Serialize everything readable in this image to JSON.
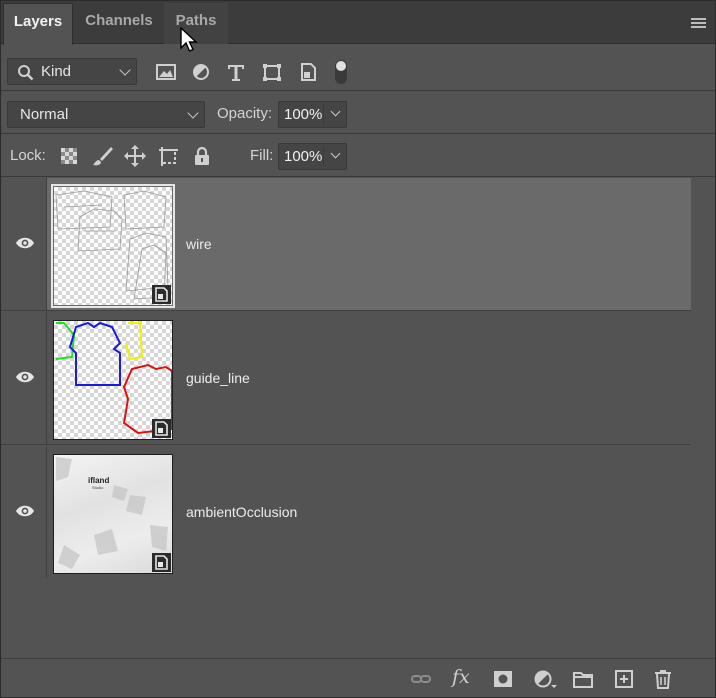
{
  "tabs": [
    {
      "label": "Layers",
      "active": true
    },
    {
      "label": "Channels",
      "active": false
    },
    {
      "label": "Paths",
      "active": false
    }
  ],
  "filter": {
    "kind_label": "Kind",
    "filter_icons": [
      "image-filter-icon",
      "adjustment-filter-icon",
      "type-filter-icon",
      "shape-filter-icon",
      "smart-object-filter-icon",
      "filter-toggle-icon"
    ]
  },
  "blend": {
    "mode": "Normal",
    "opacity_label": "Opacity:",
    "opacity_value": "100%"
  },
  "lock": {
    "label": "Lock:",
    "fill_label": "Fill:",
    "fill_value": "100%",
    "lock_icons": [
      "lock-transparent-pixels-icon",
      "lock-image-pixels-icon",
      "lock-position-icon",
      "lock-artboard-icon",
      "lock-all-icon"
    ]
  },
  "layers": [
    {
      "name": "wire",
      "selected": true,
      "visible": true
    },
    {
      "name": "guide_line",
      "selected": false,
      "visible": true
    },
    {
      "name": "ambientOcclusion",
      "selected": false,
      "visible": true
    }
  ],
  "thumb_text": {
    "brand": "ifland",
    "sub": "Studio"
  },
  "bottom_icons": [
    "link-layers-icon",
    "fx-icon",
    "add-mask-icon",
    "new-adjustment-icon",
    "new-group-icon",
    "new-layer-icon",
    "delete-layer-icon"
  ],
  "fx_label": "fx",
  "colors": {
    "panel_bg": "#535353",
    "selected_bg": "#6a6a6a",
    "tab_bar": "#3c3c3c",
    "guide_green": "#22dd22",
    "guide_blue": "#1a1ae0",
    "guide_yellow": "#f0f000",
    "guide_red": "#e01010"
  }
}
